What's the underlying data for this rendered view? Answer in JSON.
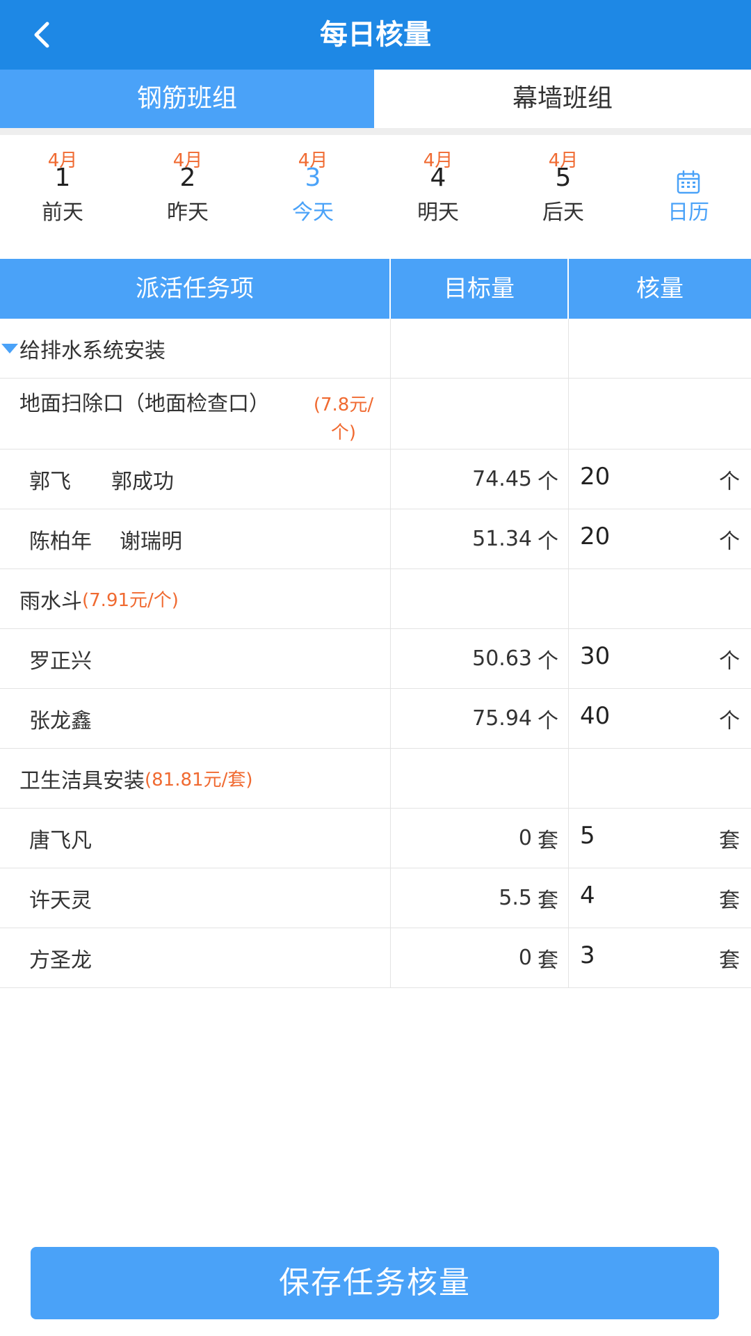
{
  "header": {
    "title": "每日核量"
  },
  "tabs": [
    {
      "label": "钢筋班组",
      "active": true
    },
    {
      "label": "幕墙班组",
      "active": false
    }
  ],
  "dates": [
    {
      "month": "4月",
      "day": "1",
      "label": "前天"
    },
    {
      "month": "4月",
      "day": "2",
      "label": "昨天"
    },
    {
      "month": "4月",
      "day": "3",
      "label": "今天"
    },
    {
      "month": "4月",
      "day": "4",
      "label": "明天"
    },
    {
      "month": "4月",
      "day": "5",
      "label": "后天"
    }
  ],
  "calendar": {
    "label": "日历"
  },
  "table": {
    "headers": [
      "派活任务项",
      "目标量",
      "核量"
    ],
    "group": "给排水系统安装",
    "items": [
      {
        "name": "地面扫除口（地面检查口）",
        "price": "(7.8元/个)",
        "workers": [
          {
            "names": [
              "郭飞",
              "郭成功"
            ],
            "target": "74.45",
            "unit": "个",
            "qty": "20"
          },
          {
            "names": [
              "陈柏年",
              "谢瑞明"
            ],
            "target": "51.34",
            "unit": "个",
            "qty": "20"
          }
        ]
      },
      {
        "name": "雨水斗",
        "price": "(7.91元/个)",
        "workers": [
          {
            "names": [
              "罗正兴"
            ],
            "target": "50.63",
            "unit": "个",
            "qty": "30"
          },
          {
            "names": [
              "张龙鑫"
            ],
            "target": "75.94",
            "unit": "个",
            "qty": "40"
          }
        ]
      },
      {
        "name": "卫生洁具安装",
        "price": "(81.81元/套)",
        "workers": [
          {
            "names": [
              "唐飞凡"
            ],
            "target": "0",
            "unit": "套",
            "qty": "5"
          },
          {
            "names": [
              "许天灵"
            ],
            "target": "5.5",
            "unit": "套",
            "qty": "4"
          },
          {
            "names": [
              "方圣龙"
            ],
            "target": "0",
            "unit": "套",
            "qty": "3"
          }
        ]
      }
    ]
  },
  "save_button": {
    "label": "保存任务核量"
  },
  "colors": {
    "header": "#1e88e5",
    "accent": "#4aa2f8",
    "price": "#f06a31"
  }
}
